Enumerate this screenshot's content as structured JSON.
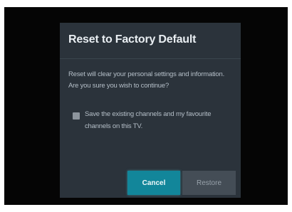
{
  "dialog": {
    "title": "Reset to Factory Default",
    "message_lines": [
      "Reset will clear your personal settings and information.",
      "Are you sure you wish to continue?"
    ],
    "checkbox": {
      "label_lines": [
        "Save the existing channels and my favourite",
        "channels on this TV."
      ],
      "checked": false
    },
    "buttons": {
      "cancel_label": "Cancel",
      "restore_label": "Restore"
    }
  },
  "colors": {
    "screen_background": "#050505",
    "dialog_background": "#2b333b",
    "cancel_button": "#12869a",
    "restore_button": "#444d56",
    "title_text": "#e9eef2",
    "body_text": "#b4bec7"
  }
}
